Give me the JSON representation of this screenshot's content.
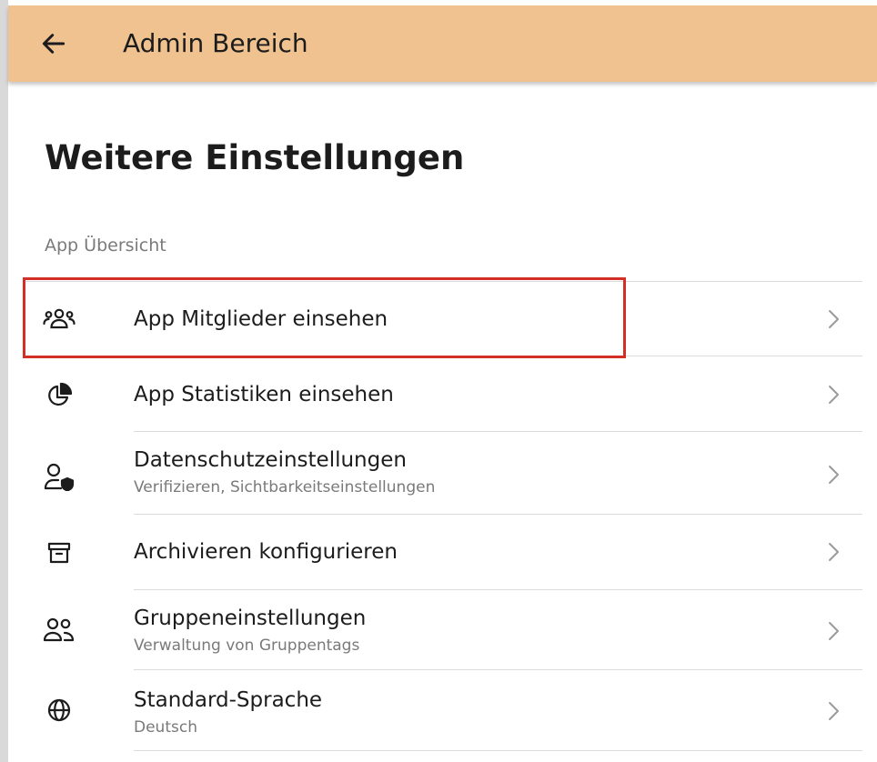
{
  "appbar": {
    "title": "Admin Bereich",
    "back_icon": "arrow-left-icon"
  },
  "page": {
    "title": "Weitere Einstellungen",
    "section_label": "App Übersicht"
  },
  "items": [
    {
      "label": "App Mitglieder einsehen",
      "subtitle": "",
      "icon": "members-icon"
    },
    {
      "label": "App Statistiken einsehen",
      "subtitle": "",
      "icon": "pie-chart-icon"
    },
    {
      "label": "Datenschutzeinstellungen",
      "subtitle": "Verifizieren, Sichtbarkeitseinstellungen",
      "icon": "user-shield-icon"
    },
    {
      "label": "Archivieren konfigurieren",
      "subtitle": "",
      "icon": "archive-icon"
    },
    {
      "label": "Gruppeneinstellungen",
      "subtitle": "Verwaltung von Gruppentags",
      "icon": "group-icon"
    },
    {
      "label": "Standard-Sprache",
      "subtitle": "Deutsch",
      "icon": "globe-icon"
    }
  ],
  "colors": {
    "appbar": "#efc28f",
    "highlight": "#d42f26",
    "divider": "#dcdcdc",
    "subtitle": "#7a7a7a"
  }
}
